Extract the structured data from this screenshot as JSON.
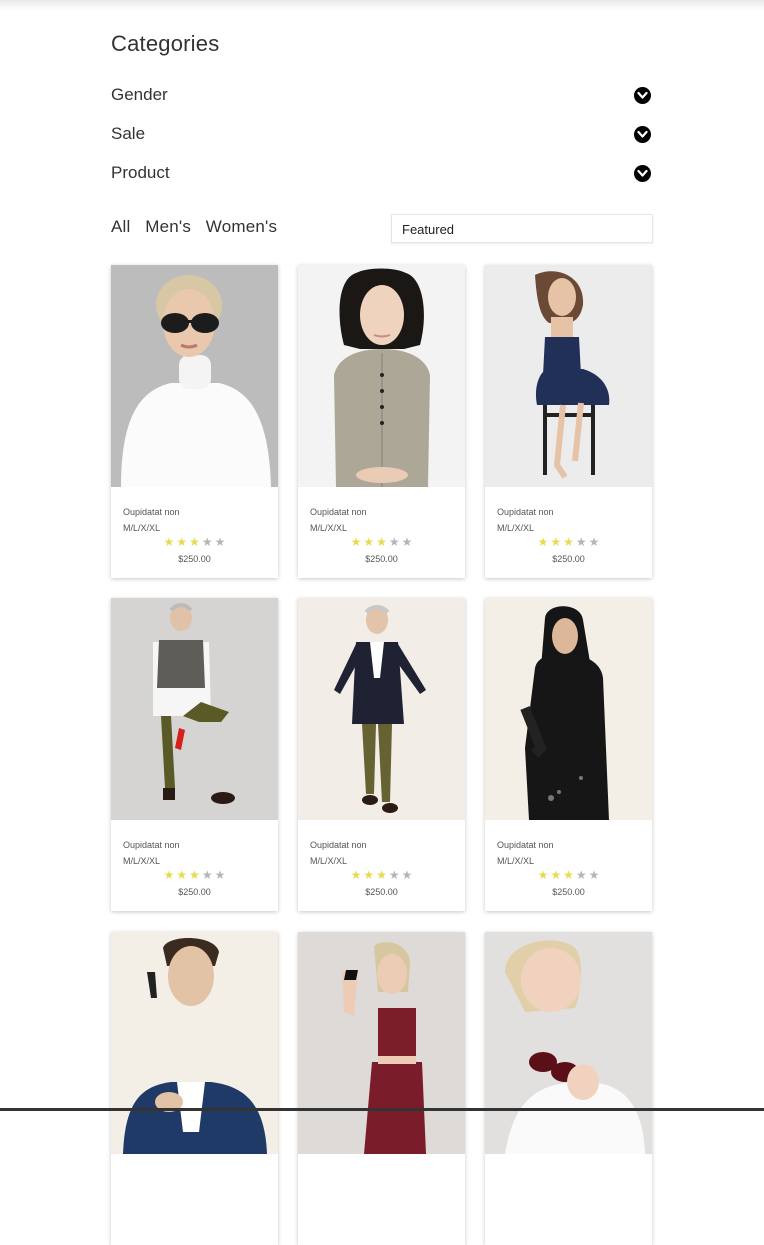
{
  "categories": {
    "title": "Categories",
    "items": [
      {
        "label": "Gender"
      },
      {
        "label": "Sale"
      },
      {
        "label": "Product"
      }
    ]
  },
  "filters": {
    "tabs": [
      "All",
      "Men's",
      "Women's"
    ],
    "sort_value": "Featured"
  },
  "colors": {
    "star_filled": "#e8dc4e",
    "star_empty": "#b5b5b5"
  },
  "products": [
    {
      "name": "Oupidatat non",
      "sizes": "M/L/X/XL",
      "rating": 3,
      "max_rating": 5,
      "price": "$250.00",
      "image": "woman-sunglasses-white-turtleneck"
    },
    {
      "name": "Oupidatat non",
      "sizes": "M/L/X/XL",
      "rating": 3,
      "max_rating": 5,
      "price": "$250.00",
      "image": "woman-khaki-dress"
    },
    {
      "name": "Oupidatat non",
      "sizes": "M/L/X/XL",
      "rating": 3,
      "max_rating": 5,
      "price": "$250.00",
      "image": "woman-navy-dress-stool"
    },
    {
      "name": "Oupidatat non",
      "sizes": "M/L/X/XL",
      "rating": 3,
      "max_rating": 5,
      "price": "$250.00",
      "image": "older-man-grey-vest"
    },
    {
      "name": "Oupidatat non",
      "sizes": "M/L/X/XL",
      "rating": 3,
      "max_rating": 5,
      "price": "$250.00",
      "image": "older-man-navy-blazer"
    },
    {
      "name": "Oupidatat non",
      "sizes": "M/L/X/XL",
      "rating": 3,
      "max_rating": 5,
      "price": "$250.00",
      "image": "woman-black-abaya"
    },
    {
      "image": "man-blue-suit-phone"
    },
    {
      "image": "woman-red-sports-top"
    },
    {
      "image": "woman-holding-sunglasses"
    }
  ]
}
